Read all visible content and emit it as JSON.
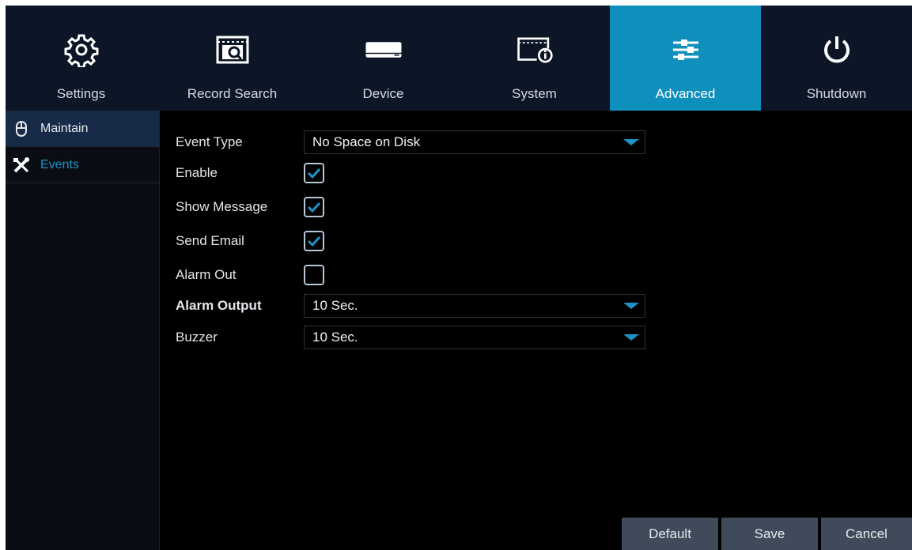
{
  "nav": {
    "tabs": [
      {
        "label": "Settings",
        "icon": "gear-icon"
      },
      {
        "label": "Record Search",
        "icon": "record-search-icon"
      },
      {
        "label": "Device",
        "icon": "hdd-device-icon"
      },
      {
        "label": "System",
        "icon": "system-info-icon"
      },
      {
        "label": "Advanced",
        "icon": "sliders-icon"
      },
      {
        "label": "Shutdown",
        "icon": "power-icon"
      }
    ],
    "active_tab": "Advanced",
    "active_color": "#0f8fbc"
  },
  "sidebar": {
    "items": [
      {
        "label": "Maintain",
        "icon": "mouse-icon"
      },
      {
        "label": "Events",
        "icon": "tools-icon"
      }
    ],
    "active_item": "Events",
    "active_color": "#1c93c6"
  },
  "form": {
    "event_type": {
      "label": "Event Type",
      "value": "No Space on Disk"
    },
    "enable": {
      "label": "Enable",
      "checked": true
    },
    "show_message": {
      "label": "Show Message",
      "checked": true
    },
    "send_email": {
      "label": "Send Email",
      "checked": true
    },
    "alarm_out": {
      "label": "Alarm Out",
      "checked": false
    },
    "alarm_output": {
      "label": "Alarm Output",
      "value": "10 Sec."
    },
    "buzzer": {
      "label": "Buzzer",
      "value": "10 Sec."
    }
  },
  "buttons": {
    "default_label": "Default",
    "save_label": "Save",
    "cancel_label": "Cancel"
  }
}
